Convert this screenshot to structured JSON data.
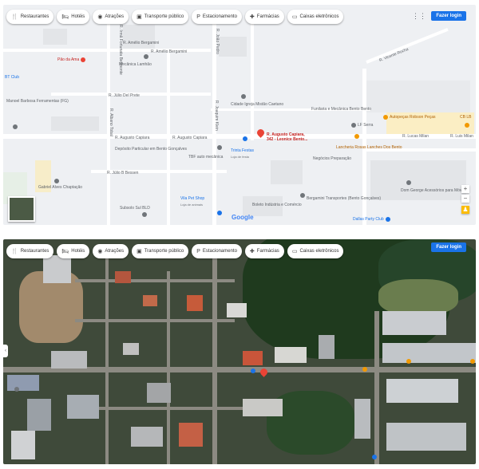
{
  "toolbar": {
    "chips": [
      {
        "label": "Restaurantes",
        "icon": "fork-knife-icon"
      },
      {
        "label": "Hotéis",
        "icon": "bed-icon"
      },
      {
        "label": "Atrações",
        "icon": "camera-icon"
      },
      {
        "label": "Transporte público",
        "icon": "bus-icon"
      },
      {
        "label": "Estacionamento",
        "icon": "parking-icon"
      },
      {
        "label": "Farmácias",
        "icon": "pharmacy-icon"
      },
      {
        "label": "Caixas eletrônicos",
        "icon": "atm-icon"
      }
    ],
    "login_label": "Fazer login"
  },
  "map": {
    "streets": {
      "beira_nort": "R. Amélio Bergamini",
      "berg2": "R. Amélio Bergamini",
      "julio_del_prete": "R. Júlio Del Prete",
      "augusto_capiara_w": "R. Augusto Capiara",
      "augusto_capiara_e": "R. Augusto Capiara",
      "joao_batista": "R. Júlio B Bessen",
      "lucas_milan_1": "R. Lucas Milan",
      "lucas_milan_2": "R. Luis Milan",
      "vert_1": "R. Irmã Fortunata Bellmonte",
      "vert_2": "R. João Pedro",
      "vert_3": "R. Albano Tobal",
      "vert_4": "R. Joaquim Klein",
      "vert_5": "R. Vicente Rocha"
    },
    "pois": {
      "pao_de_ama": "Pão da Ama",
      "mecanica": "Mecânica Lamhão",
      "igreja": "Cidade Igreja Mistão Caetano",
      "funilaria": "Funilaria e Mecânica Bento Bento",
      "destino": "R. Augusto Capiara, 342 - Leonice Bento...",
      "lf_serra": "LF Serra",
      "autopecas": "Autopeças Robson Peças",
      "lancheria": "Lancheria Rosas Lanches Dos Bento",
      "negocio": "Negócios Preparação",
      "deposito": "Depósito Particular em Bento Gonçalves",
      "tbf": "TBF auto mecânica",
      "trinta": "Trinta Festas",
      "trinta_sub": "Loja de festa",
      "bt_club": "BT Club",
      "almoxar": "Manoel Barbosa Ferramentas (FG)",
      "gabriel": "Gabriel Alves Chaptação",
      "subsolo": "Subsolo Sul BLD",
      "vila_pet": "Vila Pet Shop",
      "vila_pet_sub": "Loja de animais",
      "bergamini": "Bergamini Transportes (Bento Gonçalves)",
      "boleto": "Boleto Indústria e Comércio",
      "dom_george": "Dom George Acessórios para Móveis",
      "dallas": "Dallas Party Club",
      "cb_lb": "CB LB"
    },
    "google_mark": "Google"
  },
  "colors": {
    "pin": "#ea4335",
    "poi_blue": "#1a73e8",
    "poi_orange": "#f29900",
    "poi_green": "#188038",
    "poi_grey": "#70757a"
  }
}
